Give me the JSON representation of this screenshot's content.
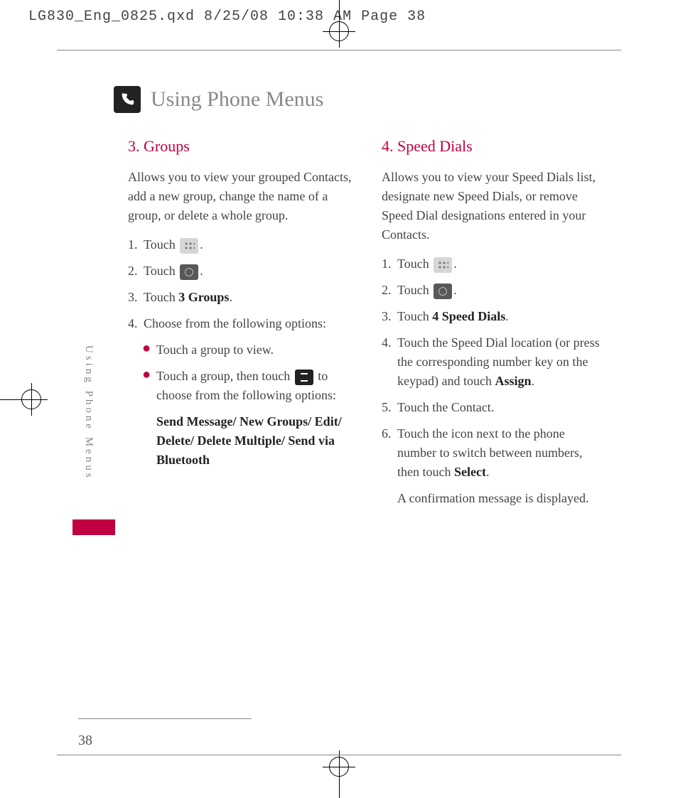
{
  "header_line": "LG830_Eng_0825.qxd  8/25/08  10:38 AM  Page 38",
  "page_title": "Using Phone Menus",
  "side_label": "Using Phone Menus",
  "page_number": "38",
  "left": {
    "heading": "3. Groups",
    "intro": "Allows you to view your grouped Contacts, add a new group, change the name of a group, or delete a whole group.",
    "step1_a": "Touch ",
    "step1_b": ".",
    "step2_a": "Touch ",
    "step2_b": ".",
    "step3_a": "Touch ",
    "step3_bold": "3 Groups",
    "step3_b": ".",
    "step4": "Choose from the following options:",
    "bullet1": "Touch a group to view.",
    "bullet2_a": "Touch a group, then touch ",
    "bullet2_b": " to choose from the following options:",
    "options_bold": "Send Message/ New Groups/ Edit/ Delete/ Delete Multiple/ Send via Bluetooth"
  },
  "right": {
    "heading": "4. Speed Dials",
    "intro": "Allows you to view your Speed Dials list, designate new Speed Dials, or remove Speed Dial designations entered in your Contacts.",
    "step1_a": "Touch ",
    "step1_b": ".",
    "step2_a": "Touch ",
    "step2_b": ".",
    "step3_a": "Touch ",
    "step3_bold": "4 Speed Dials",
    "step3_b": ".",
    "step4_a": "Touch the Speed Dial location (or press the corresponding number key on the keypad) and touch ",
    "step4_bold": "Assign",
    "step4_b": ".",
    "step5": "Touch the Contact.",
    "step6_a": "Touch the icon next to the phone number to switch between numbers, then touch ",
    "step6_bold": "Select",
    "step6_b": ".",
    "step6_after": "A confirmation message is displayed."
  }
}
